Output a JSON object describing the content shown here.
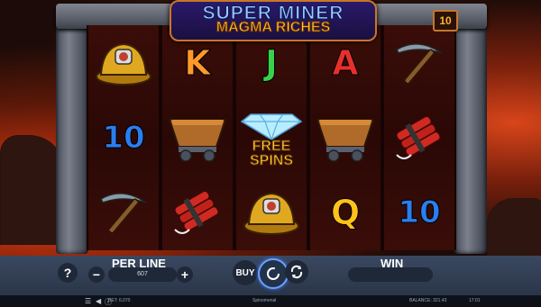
{
  "game": {
    "title_line1": "SUPER MINER",
    "title_line2": "MAGMA RICHES",
    "lines_count": "10"
  },
  "reels": [
    [
      "helmet",
      "10",
      "pickaxe"
    ],
    [
      "K",
      "minecart",
      "dynamite"
    ],
    [
      "J",
      "free-spins-diamond",
      "helmet"
    ],
    [
      "A",
      "minecart",
      "Q"
    ],
    [
      "pickaxe",
      "dynamite",
      "10"
    ]
  ],
  "symbol_colors": {
    "K": "#ff9a2a",
    "J": "#3ad14a",
    "A": "#e8302a",
    "Q": "#ffc21a",
    "10": "#2a7ef0"
  },
  "free_spins": {
    "line1": "FREE",
    "line2": "SPINS"
  },
  "controls": {
    "help_label": "?",
    "per_line_label": "PER LINE",
    "per_line_value": "607",
    "minus_label": "−",
    "plus_label": "+",
    "buy_label": "BUY",
    "win_label": "WIN"
  },
  "status_bar": {
    "bet_text": "BET: 6,070",
    "brand": "Spinomenal",
    "balance_text": "BALANCE: 321.43",
    "clock": "17:01"
  }
}
